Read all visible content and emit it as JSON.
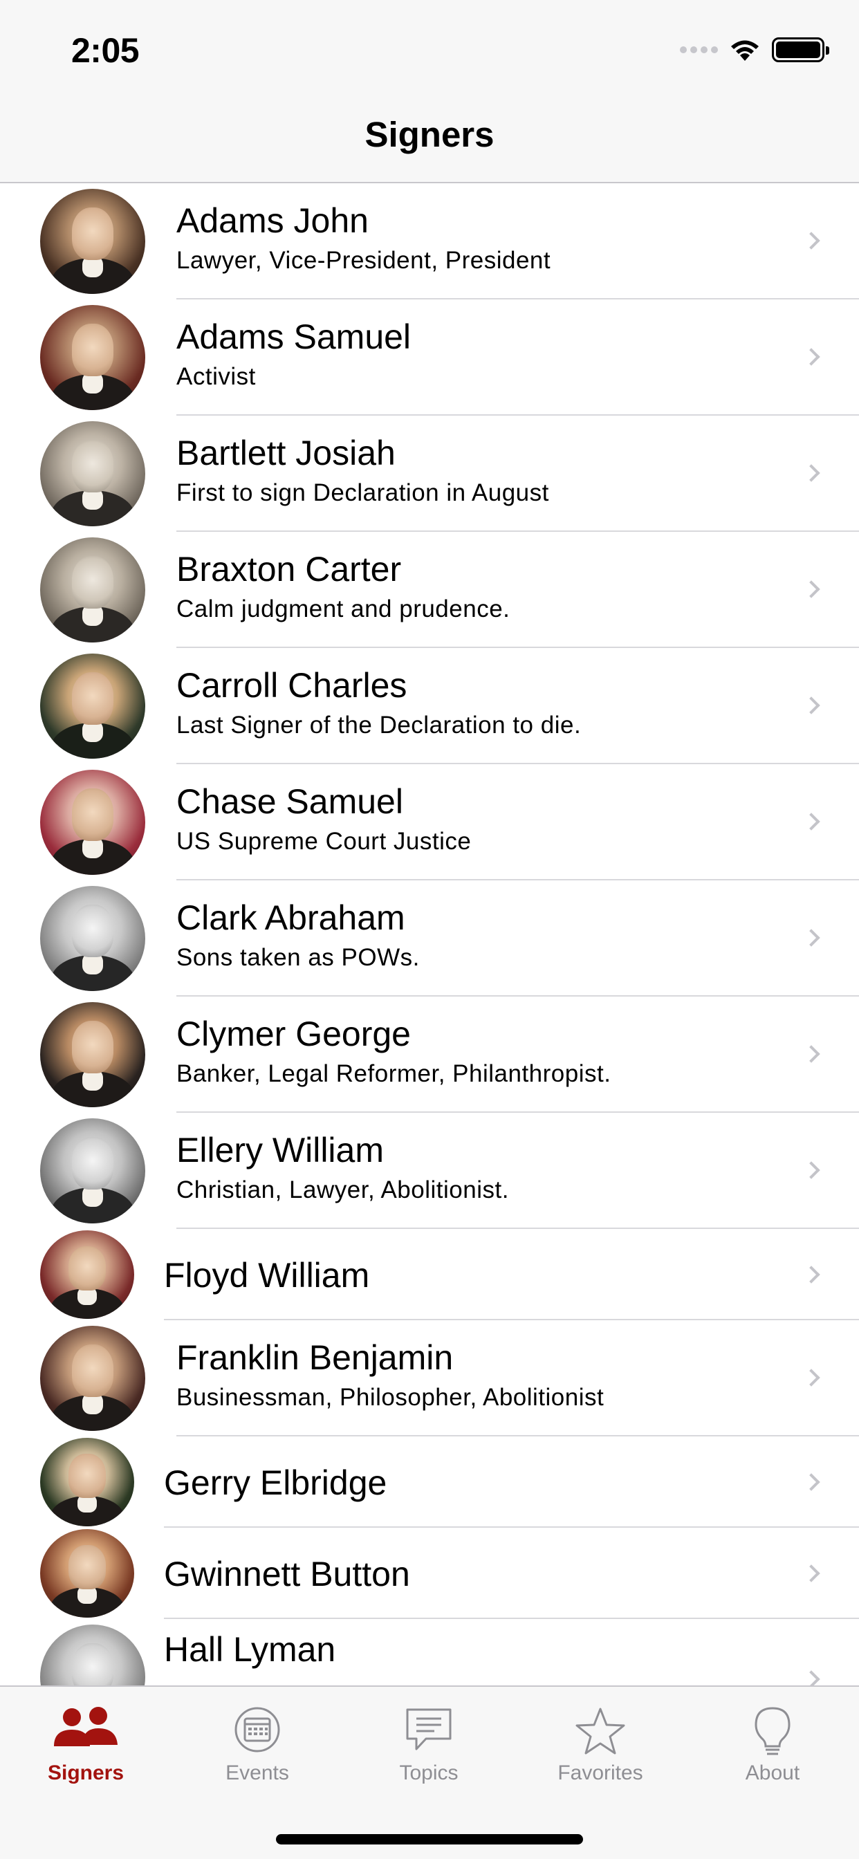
{
  "status_bar": {
    "time": "2:05"
  },
  "nav": {
    "title": "Signers"
  },
  "signers": [
    {
      "name": "Adams John",
      "subtitle": "Lawyer, Vice-President, President"
    },
    {
      "name": "Adams Samuel",
      "subtitle": "Activist"
    },
    {
      "name": "Bartlett Josiah",
      "subtitle": "First to sign Declaration in August"
    },
    {
      "name": "Braxton Carter",
      "subtitle": "Calm judgment and prudence."
    },
    {
      "name": "Carroll Charles",
      "subtitle": "Last Signer of the Declaration to die."
    },
    {
      "name": "Chase Samuel",
      "subtitle": "US Supreme Court Justice"
    },
    {
      "name": "Clark Abraham",
      "subtitle": "Sons taken as POWs."
    },
    {
      "name": "Clymer George",
      "subtitle": "Banker, Legal Reformer, Philanthropist."
    },
    {
      "name": "Ellery William",
      "subtitle": "Christian, Lawyer, Abolitionist."
    },
    {
      "name": "Floyd William"
    },
    {
      "name": "Franklin Benjamin",
      "subtitle": "Businessman, Philosopher, Abolitionist"
    },
    {
      "name": "Gerry Elbridge"
    },
    {
      "name": "Gwinnett Button"
    },
    {
      "name": "Hall Lyman"
    }
  ],
  "tabbar": {
    "tabs": [
      {
        "label": "Signers",
        "icon": "people-icon",
        "active": true
      },
      {
        "label": "Events",
        "icon": "calendar-icon",
        "active": false
      },
      {
        "label": "Topics",
        "icon": "speech-bubble-icon",
        "active": false
      },
      {
        "label": "Favorites",
        "icon": "star-icon",
        "active": false
      },
      {
        "label": "About",
        "icon": "lightbulb-icon",
        "active": false
      }
    ]
  },
  "colors": {
    "accent": "#a3130f",
    "inactive": "#8e8e93",
    "separator": "#d8d8dc",
    "chevron": "#c4c4c9"
  }
}
